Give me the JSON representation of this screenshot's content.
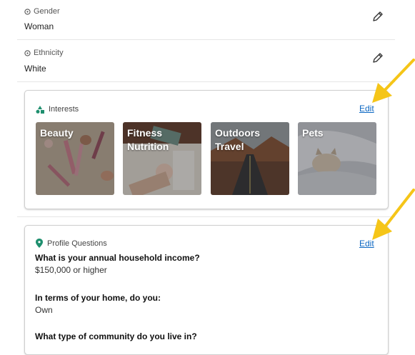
{
  "profile": {
    "gender": {
      "label": "Gender",
      "value": "Woman"
    },
    "ethnicity": {
      "label": "Ethnicity",
      "value": "White"
    }
  },
  "interests": {
    "title": "Interests",
    "edit_label": "Edit",
    "tiles": [
      {
        "lines": [
          "Beauty"
        ],
        "icon": "makeup-photo"
      },
      {
        "lines": [
          "Fitness",
          "Nutrition"
        ],
        "icon": "dumbbells-photo"
      },
      {
        "lines": [
          "Outdoors",
          "Travel"
        ],
        "icon": "road-photo"
      },
      {
        "lines": [
          "Pets"
        ],
        "icon": "cat-photo"
      }
    ]
  },
  "profile_questions": {
    "title": "Profile Questions",
    "edit_label": "Edit",
    "items": [
      {
        "question": "What is your annual household income?",
        "answer": "$150,000 or higher"
      },
      {
        "question": "In terms of your home, do you:",
        "answer": "Own"
      },
      {
        "question": "What type of community do you live in?",
        "answer": ""
      }
    ]
  },
  "colors": {
    "link": "#0a66c2",
    "icon_green": "#1e8f6e",
    "annotation_arrow": "#f5c518"
  }
}
